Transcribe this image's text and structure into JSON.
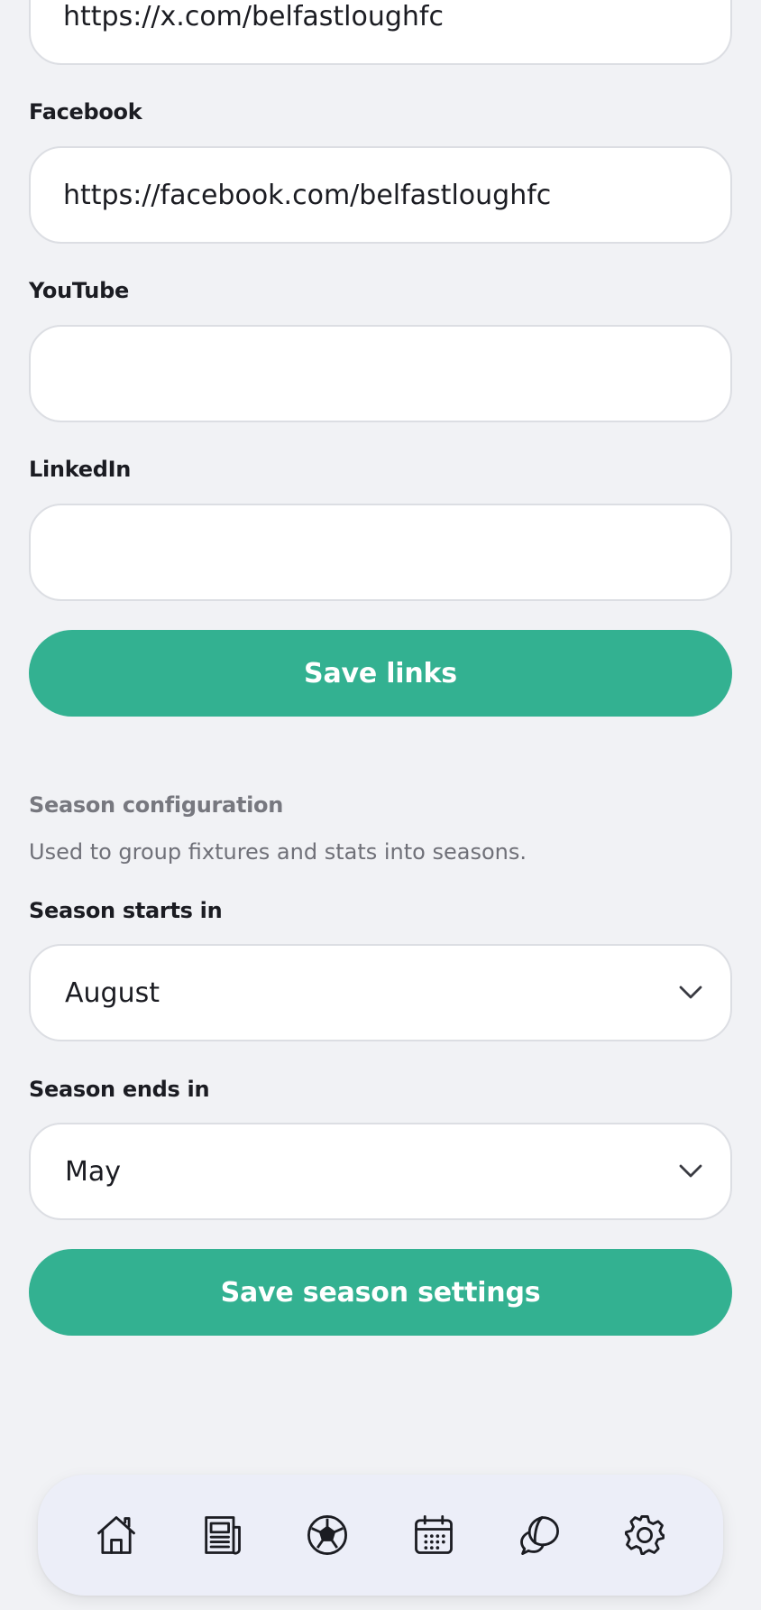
{
  "social_links": {
    "x_value": "https://x.com/belfastloughfc",
    "facebook_label": "Facebook",
    "facebook_value": "https://facebook.com/belfastloughfc",
    "youtube_label": "YouTube",
    "youtube_value": "",
    "linkedin_label": "LinkedIn",
    "linkedin_value": "",
    "save_label": "Save links"
  },
  "season": {
    "section_title": "Season configuration",
    "description": "Used to group fixtures and stats into seasons.",
    "starts_label": "Season starts in",
    "starts_value": "August",
    "ends_label": "Season ends in",
    "ends_value": "May",
    "save_label": "Save season settings"
  },
  "bottom_nav": {
    "items": [
      "home-icon",
      "news-icon",
      "football-icon",
      "calendar-icon",
      "chat-icon",
      "settings-icon"
    ]
  },
  "colors": {
    "accent": "#33b191",
    "background": "#f1f2f5",
    "nav_background": "#eceef8"
  }
}
